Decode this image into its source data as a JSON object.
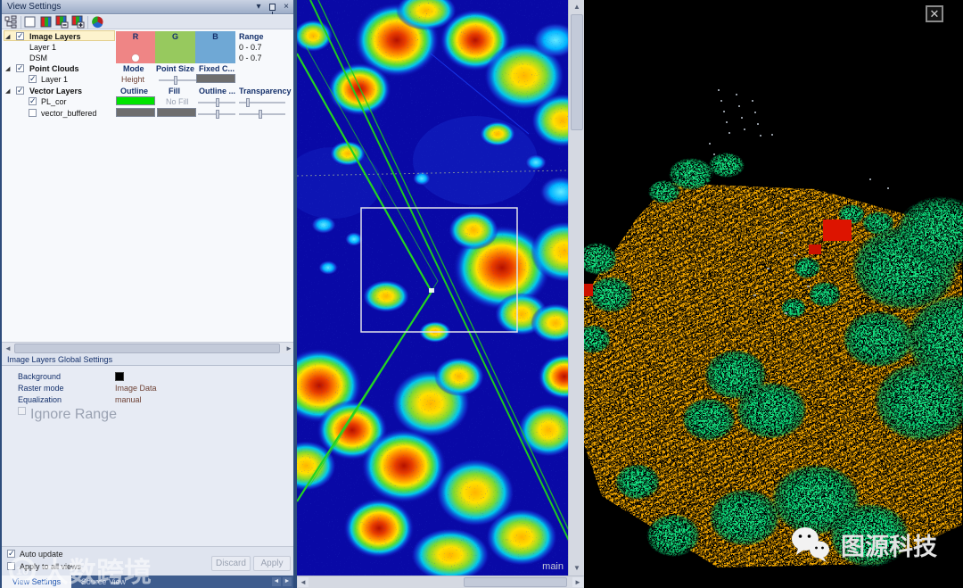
{
  "panel": {
    "title": "View Settings",
    "titlebar_icons": [
      "collapse-arrow",
      "pin",
      "close"
    ],
    "toolbar_icons": [
      "layer-tree",
      "image-layer",
      "rgb-bands",
      "rgb-band-remove",
      "rgb-band-add",
      "color-sphere"
    ],
    "tree": {
      "image_group": {
        "label": "Image Layers",
        "checked": true,
        "selected": true,
        "col_r": "R",
        "col_g": "G",
        "col_b": "B",
        "col_range": "Range",
        "layers": [
          {
            "name": "Layer 1",
            "range": "0 - 0.7"
          },
          {
            "name": "DSM",
            "range": "0 - 0.7",
            "active_channel": "R"
          }
        ]
      },
      "point_group": {
        "label": "Point Clouds",
        "checked": true,
        "col_mode": "Mode",
        "col_point_size": "Point Size",
        "col_fixed": "Fixed C...",
        "layers": [
          {
            "name": "Layer 1",
            "checked": true,
            "mode": "Height"
          }
        ]
      },
      "vector_group": {
        "label": "Vector Layers",
        "checked": true,
        "col_outline": "Outline",
        "col_fill": "Fill",
        "col_outline2": "Outline ...",
        "col_transparency": "Transparency",
        "layers": [
          {
            "name": "PL_cor",
            "checked": true,
            "outline_color": "#00e400",
            "fill": "No Fill"
          },
          {
            "name": "vector_buffered",
            "checked": false,
            "outline_color": "#6e6e6e",
            "fill_color": "#6e6e6e"
          }
        ]
      }
    },
    "global_settings": {
      "title": "Image Layers Global Settings",
      "background_label": "Background",
      "background_color": "#000000",
      "raster_mode_label": "Raster mode",
      "raster_mode_value": "Image Data",
      "equalization_label": "Equalization",
      "equalization_value": "manual",
      "ignore_range_label": "Ignore Range",
      "ignore_range_checked": false
    },
    "footer": {
      "auto_update": "Auto update",
      "auto_update_checked": true,
      "apply_all_views": "Apply to all views",
      "apply_all_views_checked": false,
      "discard": "Discard",
      "apply": "Apply"
    },
    "tabs": [
      {
        "label": "View Settings",
        "active": true
      },
      {
        "label": "Source View",
        "active": false
      }
    ]
  },
  "viewer2d": {
    "name_label": "main",
    "selection_rectangle": true,
    "vector_line_color": "#1ecc1e"
  },
  "viewer3d": {
    "close_icon": "close"
  },
  "watermarks": {
    "left_logo": "ring-logo",
    "left_text": "大数跨境",
    "right_logo": "wechat-logo",
    "right_text": "图源科技"
  },
  "colors": {
    "band_r": "#ef8585",
    "band_g": "#97c95e",
    "band_b": "#6fa8d5",
    "selection_yellow": "#fdf3cd",
    "outline_green": "#00e400",
    "heatmap_background": "#0909a6",
    "terrain_orange": "#eda400",
    "trees_green": "#12df7f"
  }
}
